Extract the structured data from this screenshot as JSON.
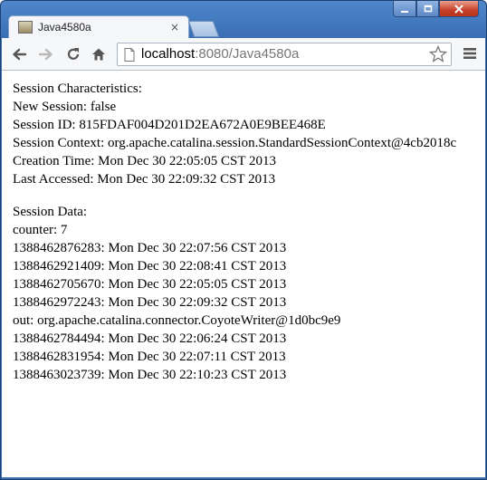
{
  "tab": {
    "title": "Java4580a",
    "close_glyph": "×",
    "favicon": "java-favicon-icon"
  },
  "toolbar": {
    "back_icon": "arrow-left-icon",
    "forward_icon": "arrow-right-icon",
    "reload_icon": "reload-icon",
    "home_icon": "home-icon",
    "url_host": "localhost",
    "url_rest": ":8080/Java4580a",
    "bookmark_icon": "star-icon",
    "menu_icon": "hamburger-menu-icon"
  },
  "colors": {
    "frame": "#3a6fb5",
    "close_button": "#c6402a",
    "toolbar": "#f6f7f9"
  },
  "characteristics": {
    "heading": "Session Characteristics:",
    "lines": [
      "New Session: false",
      "Session ID: 815FDAF004D201D2EA672A0E9BEE468E",
      "Session Context: org.apache.catalina.session.StandardSessionContext@4cb2018c",
      "Creation Time: Mon Dec 30 22:05:05 CST 2013",
      "Last Accessed: Mon Dec 30 22:09:32 CST 2013"
    ]
  },
  "session_data": {
    "heading": "Session Data:",
    "lines": [
      "counter: 7",
      "1388462876283: Mon Dec 30 22:07:56 CST 2013",
      "1388462921409: Mon Dec 30 22:08:41 CST 2013",
      "1388462705670: Mon Dec 30 22:05:05 CST 2013",
      "1388462972243: Mon Dec 30 22:09:32 CST 2013",
      "out: org.apache.catalina.connector.CoyoteWriter@1d0bc9e9",
      "1388462784494: Mon Dec 30 22:06:24 CST 2013",
      "1388462831954: Mon Dec 30 22:07:11 CST 2013",
      "1388463023739: Mon Dec 30 22:10:23 CST 2013"
    ]
  }
}
